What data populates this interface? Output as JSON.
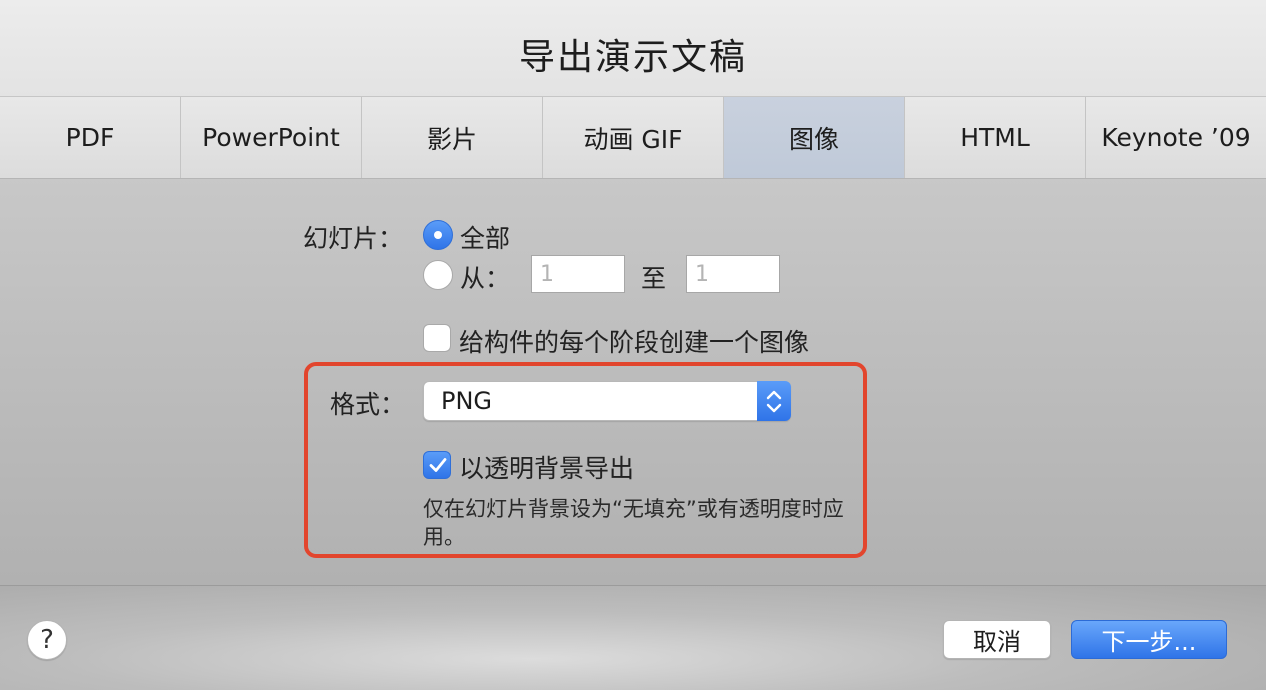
{
  "dialog": {
    "title": "导出演示文稿"
  },
  "tabs": [
    {
      "label": "PDF",
      "selected": false
    },
    {
      "label": "PowerPoint",
      "selected": false
    },
    {
      "label": "影片",
      "selected": false
    },
    {
      "label": "动画 GIF",
      "selected": false
    },
    {
      "label": "图像",
      "selected": true
    },
    {
      "label": "HTML",
      "selected": false
    },
    {
      "label": "Keynote ’09",
      "selected": false
    }
  ],
  "slides": {
    "label": "幻灯片：",
    "all_label": "全部",
    "all_selected": true,
    "from_label": "从：",
    "from_selected": false,
    "to_label": "至",
    "from_placeholder": "1",
    "to_placeholder": "1"
  },
  "build_stages": {
    "label": "给构件的每个阶段创建一个图像",
    "checked": false
  },
  "format": {
    "label": "格式：",
    "value": "PNG"
  },
  "transparent": {
    "label": "以透明背景导出",
    "checked": true,
    "note": "仅在幻灯片背景设为“无填充”或有透明度时应用。"
  },
  "footer": {
    "help_label": "?",
    "cancel_label": "取消",
    "next_label": "下一步..."
  },
  "colors": {
    "accent": "#2f74e8",
    "highlight": "#e2452d",
    "selected_tab": "#c5cedc"
  }
}
